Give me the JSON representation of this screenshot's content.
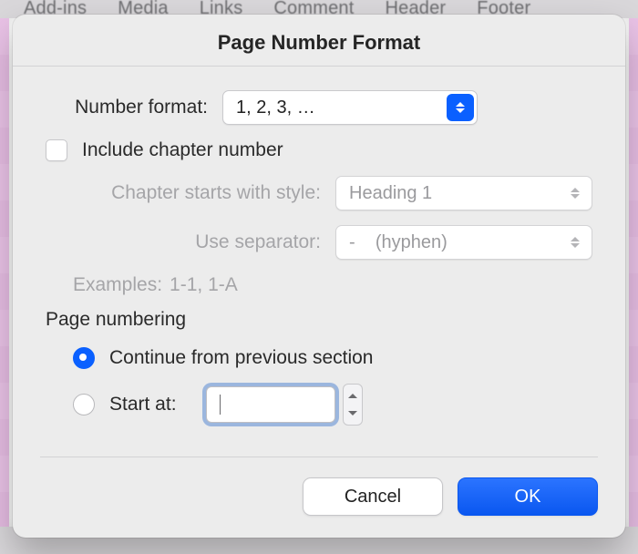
{
  "ribbon": {
    "items": [
      "Add-ins",
      "Media",
      "Links",
      "Comment",
      "Header",
      "Footer"
    ]
  },
  "dialog": {
    "title": "Page Number Format",
    "number_format": {
      "label": "Number format:",
      "value": "1, 2, 3, …"
    },
    "include_chapter": {
      "label": "Include chapter number",
      "checked": false
    },
    "chapter_style": {
      "label": "Chapter starts with style:",
      "value": "Heading 1"
    },
    "separator": {
      "label": "Use separator:",
      "value": "-    (hyphen)"
    },
    "examples": {
      "label": "Examples:",
      "value": "1-1, 1-A"
    },
    "page_numbering": {
      "label": "Page numbering",
      "continue_label": "Continue from previous section",
      "startat_label": "Start at:",
      "selected": "continue",
      "startat_value": ""
    },
    "buttons": {
      "cancel": "Cancel",
      "ok": "OK"
    }
  }
}
